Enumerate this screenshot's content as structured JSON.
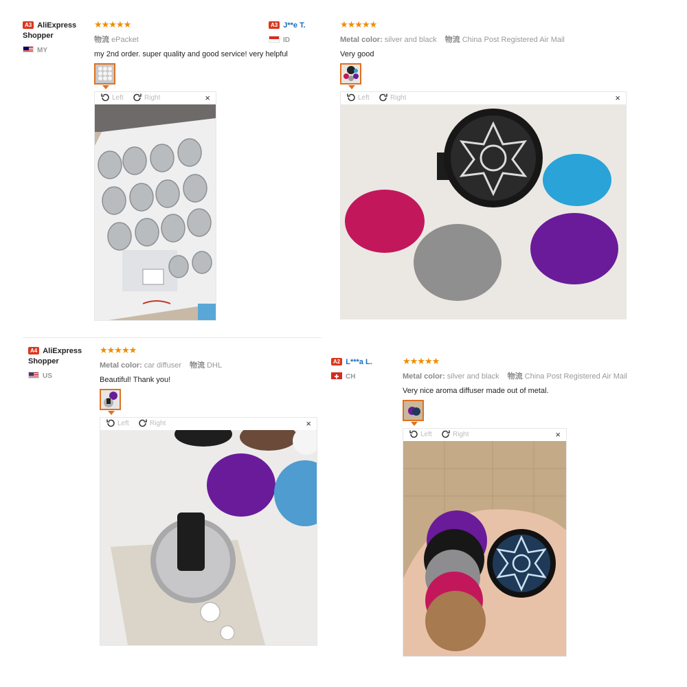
{
  "reviews": [
    {
      "level": "A3",
      "name_line1": "AliExpress",
      "name_line2": "Shopper",
      "country": "MY",
      "stars": "★★★★★",
      "meta": [
        {
          "key": "物流",
          "value": "ePacket"
        }
      ],
      "text": "my 2nd order. super quality and good service! very helpful"
    },
    {
      "level": "A3",
      "name_line1": "J**e T.",
      "country": "ID",
      "stars": "★★★★★",
      "meta": [
        {
          "key": "Metal color:",
          "value": "silver and black"
        },
        {
          "key": "物流",
          "value": "China Post Registered Air Mail"
        }
      ],
      "text": "Very good"
    },
    {
      "level": "A4",
      "name_line1": "AliExpress",
      "name_line2": "Shopper",
      "country": "US",
      "stars": "★★★★★",
      "meta": [
        {
          "key": "Metal color:",
          "value": "car diffuser"
        },
        {
          "key": "物流",
          "value": "DHL"
        }
      ],
      "text": "Beautiful! Thank you!"
    },
    {
      "level": "A2",
      "name_line1": "L***a L.",
      "country": "CH",
      "stars": "★★★★★",
      "meta": [
        {
          "key": "Metal color:",
          "value": "silver and black"
        },
        {
          "key": "物流",
          "value": "China Post Registered Air Mail"
        }
      ],
      "text": "Very nice aroma diffuser made out of metal."
    }
  ],
  "viewer": {
    "rotate_left": "Left",
    "rotate_right": "Right",
    "close": "×"
  },
  "icons": {
    "rotate_left": "rotate-left-icon",
    "rotate_right": "rotate-right-icon",
    "close": "close-icon"
  }
}
